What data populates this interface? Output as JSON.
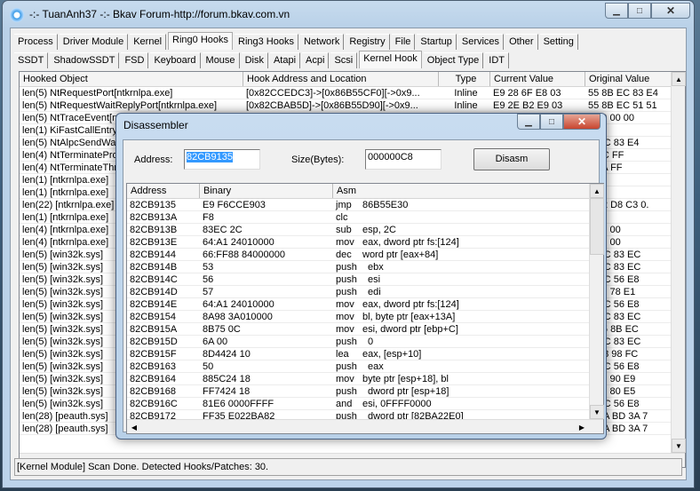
{
  "window": {
    "title": "-:- TuanAnh37 -:- Bkav Forum-http://forum.bkav.com.vn",
    "controls": {
      "minimize": "▁",
      "maximize": "□",
      "close": "✕"
    }
  },
  "main_tabs": [
    {
      "label": "Process",
      "active": false
    },
    {
      "label": "Driver Module",
      "active": false
    },
    {
      "label": "Kernel",
      "active": false
    },
    {
      "label": "Ring0 Hooks",
      "active": true
    },
    {
      "label": "Ring3 Hooks",
      "active": false
    },
    {
      "label": "Network",
      "active": false
    },
    {
      "label": "Registry",
      "active": false
    },
    {
      "label": "File",
      "active": false
    },
    {
      "label": "Startup",
      "active": false
    },
    {
      "label": "Services",
      "active": false
    },
    {
      "label": "Other",
      "active": false
    },
    {
      "label": "Setting",
      "active": false
    }
  ],
  "sub_tabs": [
    {
      "label": "SSDT",
      "active": false
    },
    {
      "label": "ShadowSSDT",
      "active": false
    },
    {
      "label": "FSD",
      "active": false
    },
    {
      "label": "Keyboard",
      "active": false
    },
    {
      "label": "Mouse",
      "active": false
    },
    {
      "label": "Disk",
      "active": false
    },
    {
      "label": "Atapi",
      "active": false
    },
    {
      "label": "Acpi",
      "active": false
    },
    {
      "label": "Scsi",
      "active": false
    },
    {
      "label": "Kernel Hook",
      "active": true
    },
    {
      "label": "Object Type",
      "active": false
    },
    {
      "label": "IDT",
      "active": false
    }
  ],
  "hook_table": {
    "columns": [
      "Hooked Object",
      "Hook Address and Location",
      "Type",
      "Current Value",
      "Original Value"
    ],
    "rows": [
      [
        "len(5) NtRequestPort[ntkrnlpa.exe]",
        "[0x82CCEDC3]->[0x86B55CF0][->0x9...",
        "Inline",
        "E9 28 6F E8 03",
        "55 8B EC 83 E4"
      ],
      [
        "len(5) NtRequestWaitReplyPort[ntkrnlpa.exe]",
        "[0x82CBAB5D]->[0x86B55D90][->0x9...",
        "Inline",
        "E9 2E B2 E9 03",
        "55 8B EC 51 51"
      ],
      [
        "len(5) NtTraceEvent[ntkrnlpa.exe]",
        "",
        "",
        "",
        "4 00 00 00"
      ],
      [
        "len(1) KiFastCallEntry[ntkrnlpa.exe]",
        "",
        "",
        "",
        ""
      ],
      [
        "len(5) NtAlpcSendWaitReceivePort[ntkrnlpa.exe]",
        "",
        "",
        "",
        "B EC 83 E4"
      ],
      [
        "len(4) NtTerminateProcess[ntkrnlpa.exe]",
        "",
        "",
        "",
        "5 FC FF"
      ],
      [
        "len(4) NtTerminateThread[ntkrnlpa.exe]",
        "",
        "",
        "",
        "7 FA FF"
      ],
      [
        "len(1) [ntkrnlpa.exe]",
        "",
        "",
        "",
        ""
      ],
      [
        "len(1) [ntkrnlpa.exe]",
        "",
        "",
        "",
        ""
      ],
      [
        "len(22) [ntkrnlpa.exe]",
        "",
        "",
        "",
        "F 22 D8 C3 0."
      ],
      [
        "len(1) [ntkrnlpa.exe]",
        "",
        "",
        "",
        ""
      ],
      [
        "len(4) [ntkrnlpa.exe]",
        "",
        "",
        "",
        "3 03 00"
      ],
      [
        "len(4) [ntkrnlpa.exe]",
        "",
        "",
        "",
        "2 00 00"
      ],
      [
        "len(5) [win32k.sys]",
        "",
        "",
        "",
        "B EC 83 EC"
      ],
      [
        "len(5) [win32k.sys]",
        "",
        "",
        "",
        "B EC 83 EC"
      ],
      [
        "len(5) [win32k.sys]",
        "",
        "",
        "",
        "B EC 56 E8"
      ],
      [
        "len(5) [win32k.sys]",
        "",
        "",
        "",
        "8 68 78 E1"
      ],
      [
        "len(5) [win32k.sys]",
        "",
        "",
        "",
        "B EC 56 E8"
      ],
      [
        "len(5) [win32k.sys]",
        "",
        "",
        "",
        "B EC 83 EC"
      ],
      [
        "len(5) [win32k.sys]",
        "",
        "",
        "",
        "F 55 8B EC"
      ],
      [
        "len(5) [win32k.sys]",
        "",
        "",
        "",
        "B EC 83 EC"
      ],
      [
        "len(5) [win32k.sys]",
        "",
        "",
        "",
        "C 68 98 FC"
      ],
      [
        "len(5) [win32k.sys]",
        "",
        "",
        "",
        "B EC 56 E8"
      ],
      [
        "len(5) [win32k.sys]",
        "",
        "",
        "",
        "8 68 90 E9"
      ],
      [
        "len(5) [win32k.sys]",
        "",
        "",
        "",
        "8 68 80 E5"
      ],
      [
        "len(5) [win32k.sys]",
        "",
        "",
        "",
        "B EC 56 E8"
      ],
      [
        "len(28) [peauth.sys]",
        "",
        "",
        "",
        "7 DA BD 3A 7"
      ],
      [
        "len(28) [peauth.sys]",
        "",
        "",
        "",
        "7 DA BD 3A 7"
      ]
    ]
  },
  "status_bar": "[Kernel Module] Scan Done. Detected Hooks/Patches: 30.",
  "dialog": {
    "title": "Disassembler",
    "address_label": "Address:",
    "address_value": "82CB9135",
    "size_label": "Size(Bytes):",
    "size_value": "000000C8",
    "disasm_button": "Disasm",
    "columns": [
      "Address",
      "Binary",
      "Asm"
    ],
    "rows": [
      [
        "82CB9135",
        "E9 F6CCE903",
        "jmp",
        "86B55E30"
      ],
      [
        "82CB913A",
        "F8",
        "clc",
        ""
      ],
      [
        "82CB913B",
        "83EC 2C",
        "sub",
        "esp, 2C"
      ],
      [
        "82CB913E",
        "64:A1 24010000",
        "mov",
        "eax, dword ptr fs:[124]"
      ],
      [
        "82CB9144",
        "66:FF88 84000000",
        "dec",
        "word ptr [eax+84]"
      ],
      [
        "82CB914B",
        "53",
        "push",
        "ebx"
      ],
      [
        "82CB914C",
        "56",
        "push",
        "esi"
      ],
      [
        "82CB914D",
        "57",
        "push",
        "edi"
      ],
      [
        "82CB914E",
        "64:A1 24010000",
        "mov",
        "eax, dword ptr fs:[124]"
      ],
      [
        "82CB9154",
        "8A98 3A010000",
        "mov",
        "bl, byte ptr [eax+13A]"
      ],
      [
        "82CB915A",
        "8B75 0C",
        "mov",
        "esi, dword ptr [ebp+C]"
      ],
      [
        "82CB915D",
        "6A 00",
        "push",
        "0"
      ],
      [
        "82CB915F",
        "8D4424 10",
        "lea",
        "eax, [esp+10]"
      ],
      [
        "82CB9163",
        "50",
        "push",
        "eax"
      ],
      [
        "82CB9164",
        "885C24 18",
        "mov",
        "byte ptr [esp+18], bl"
      ],
      [
        "82CB9168",
        "FF7424 18",
        "push",
        "dword ptr [esp+18]"
      ],
      [
        "82CB916C",
        "81E6 0000FFFF",
        "and",
        "esi, 0FFFF0000"
      ],
      [
        "82CB9172",
        "FF35 E022BA82",
        "push",
        "dword ptr [82BA22E0]"
      ]
    ]
  },
  "icons": {
    "scroll_up": "▲",
    "scroll_down": "▼",
    "scroll_left": "◀",
    "scroll_right": "▶"
  }
}
